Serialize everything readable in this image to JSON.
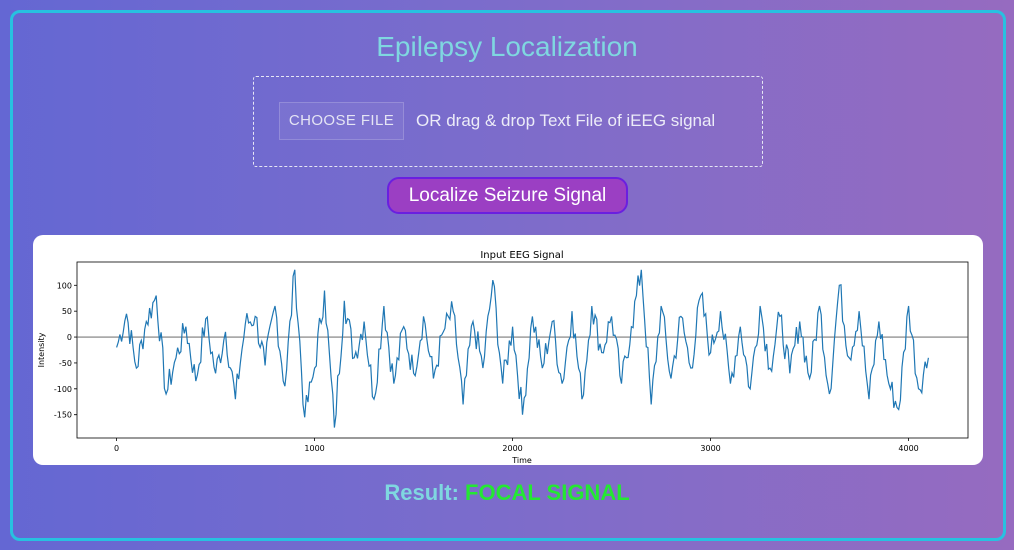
{
  "header": {
    "title": "Epilepsy Localization"
  },
  "upload": {
    "button_label": "CHOOSE FILE",
    "hint": "OR drag & drop Text File of iEEG signal"
  },
  "actions": {
    "localize_label": "Localize Seizure Signal"
  },
  "result": {
    "label": "Result:",
    "value": "FOCAL SIGNAL"
  },
  "colors": {
    "title": "#7fd7e0",
    "frame_border": "#27c1e0",
    "button_bg": "#9b3fc3",
    "button_border": "#6a1fe0",
    "result_value": "#24e833",
    "signal_line": "#1f77b4"
  },
  "chart_data": {
    "type": "line",
    "title": "Input EEG Signal",
    "xlabel": "Time",
    "ylabel": "Intensity",
    "xlim": [
      -200,
      4300
    ],
    "ylim": [
      -195,
      145
    ],
    "xticks": [
      0,
      1000,
      2000,
      3000,
      4000
    ],
    "yticks": [
      100,
      50,
      0,
      -50,
      -100,
      -150
    ],
    "hline": 0,
    "grid": false,
    "series": [
      {
        "x": [
          0,
          50,
          100,
          150,
          200,
          250,
          300,
          350,
          400,
          450,
          500,
          550,
          600,
          650,
          700,
          750,
          800,
          850,
          900,
          950,
          1000,
          1050,
          1100,
          1150,
          1200,
          1250,
          1300,
          1350,
          1400,
          1450,
          1500,
          1550,
          1600,
          1650,
          1700,
          1750,
          1800,
          1850,
          1900,
          1950,
          2000,
          2050,
          2100,
          2150,
          2200,
          2250,
          2300,
          2350,
          2400,
          2450,
          2500,
          2550,
          2600,
          2650,
          2700,
          2750,
          2800,
          2850,
          2900,
          2950,
          3000,
          3050,
          3100,
          3150,
          3200,
          3250,
          3300,
          3350,
          3400,
          3450,
          3500,
          3550,
          3600,
          3650,
          3700,
          3750,
          3800,
          3850,
          3900,
          3950,
          4000,
          4050,
          4100
        ],
        "values": [
          -20,
          45,
          -60,
          30,
          80,
          -110,
          -40,
          20,
          -85,
          35,
          -70,
          10,
          -120,
          25,
          40,
          -55,
          60,
          -95,
          130,
          -155,
          -60,
          90,
          -175,
          70,
          -40,
          30,
          -120,
          60,
          -90,
          20,
          -70,
          40,
          -80,
          10,
          50,
          -130,
          30,
          -60,
          110,
          -90,
          20,
          -150,
          40,
          -60,
          30,
          -90,
          50,
          -120,
          60,
          -30,
          40,
          -90,
          20,
          130,
          -130,
          60,
          -80,
          40,
          -60,
          80,
          -30,
          50,
          -90,
          20,
          -100,
          60,
          -60,
          40,
          -70,
          30,
          -80,
          60,
          -110,
          100,
          -40,
          50,
          -120,
          30,
          -90,
          -140,
          60,
          -100,
          -40
        ]
      }
    ]
  }
}
